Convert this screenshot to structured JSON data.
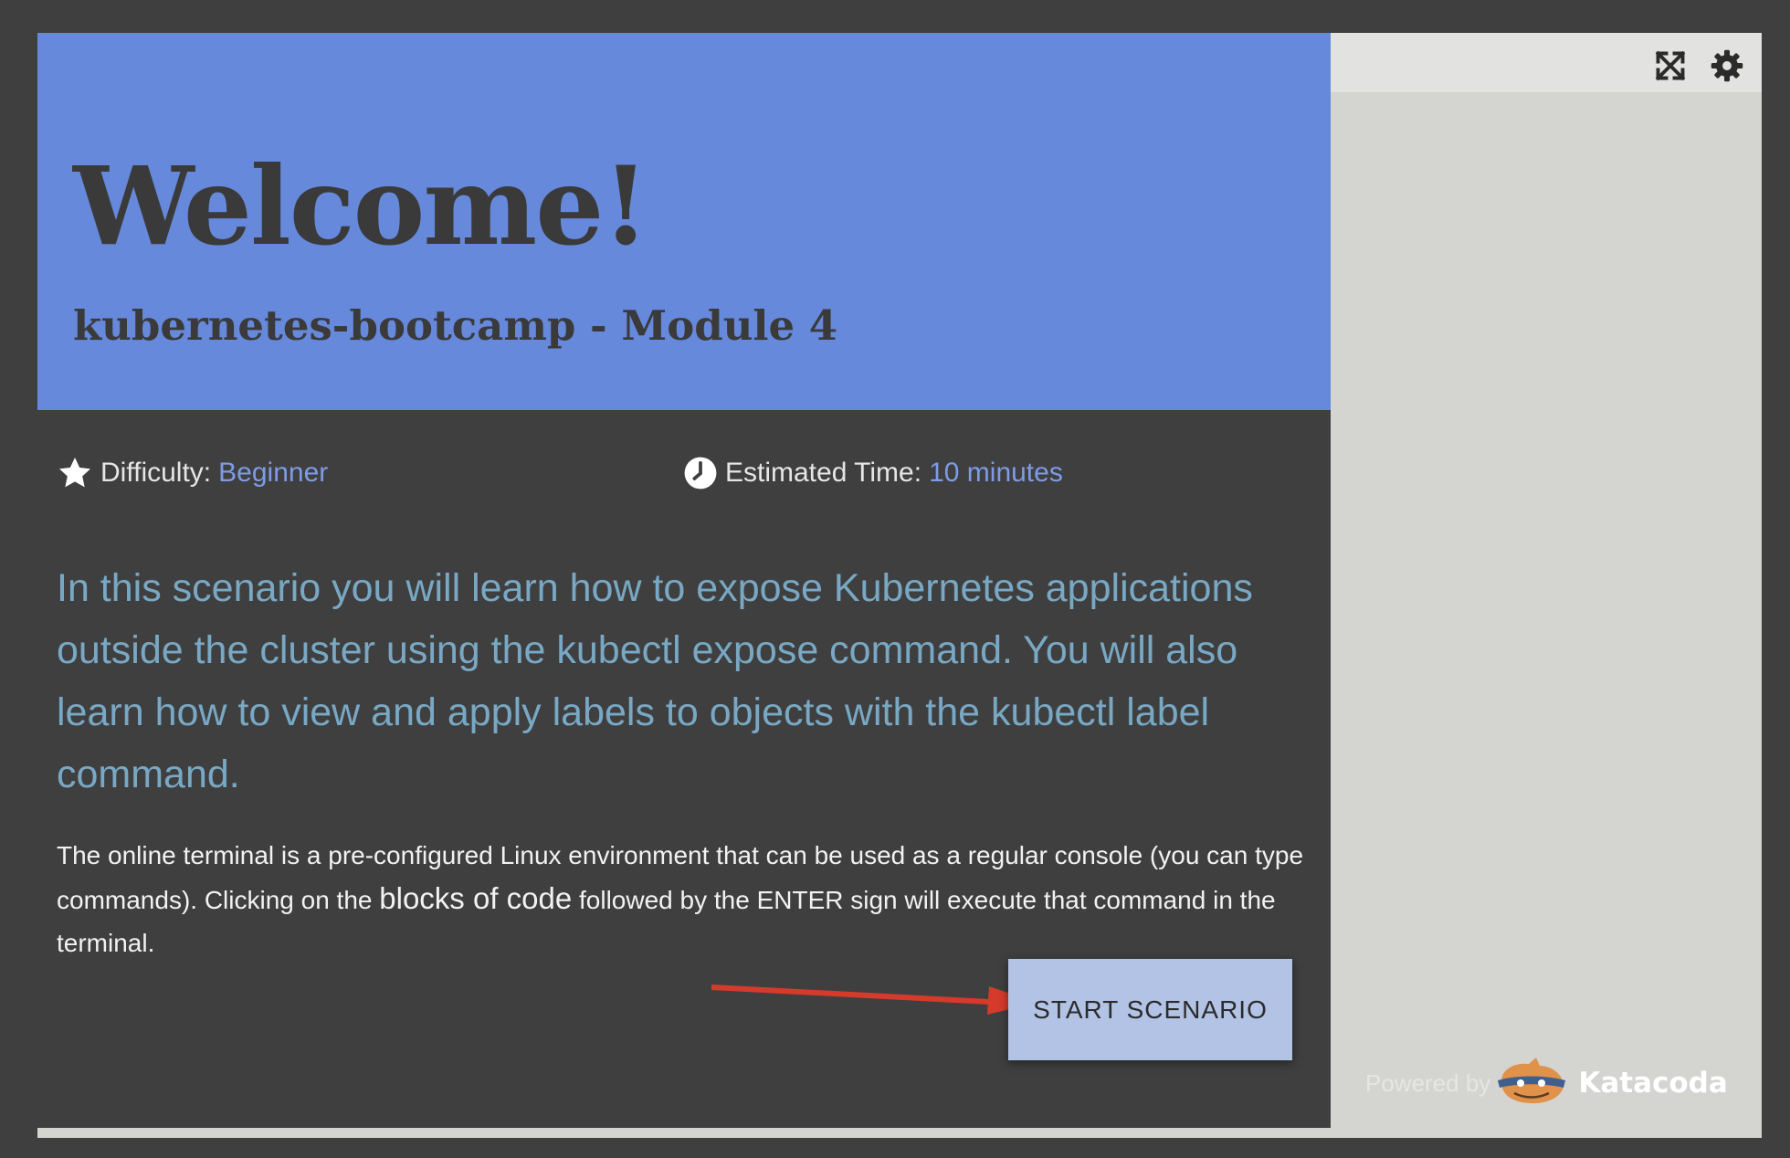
{
  "hero": {
    "title": "Welcome!",
    "subtitle": "kubernetes-bootcamp - Module 4",
    "background_color": "#6689db"
  },
  "meta": {
    "difficulty_label": "Difficulty:",
    "difficulty_value": "Beginner",
    "difficulty_icon": "star-icon",
    "time_label": "Estimated Time:",
    "time_value": "10 minutes",
    "time_icon": "clock-icon",
    "accent_color": "#7f9be6"
  },
  "intro": {
    "text": "In this scenario you will learn how to expose Kubernetes applications outside the cluster using the kubectl expose command. You will also learn how to view and apply labels to objects with the kubectl label command.",
    "color": "#79a8c4"
  },
  "body": {
    "part1": "The online terminal is a pre-configured Linux environment that can be used as a regular console (you can type commands). Clicking on the ",
    "highlight": "blocks of code",
    "part2": " followed by the ENTER sign will execute that command in the terminal."
  },
  "actions": {
    "start_label": "START SCENARIO",
    "button_color": "#b2c3e6",
    "arrow_color": "#d63a2b"
  },
  "right_panel": {
    "toolbar_icons": [
      "expand-icon",
      "gear-icon"
    ],
    "powered_by_label": "Powered by",
    "brand_name": "Katacoda"
  }
}
